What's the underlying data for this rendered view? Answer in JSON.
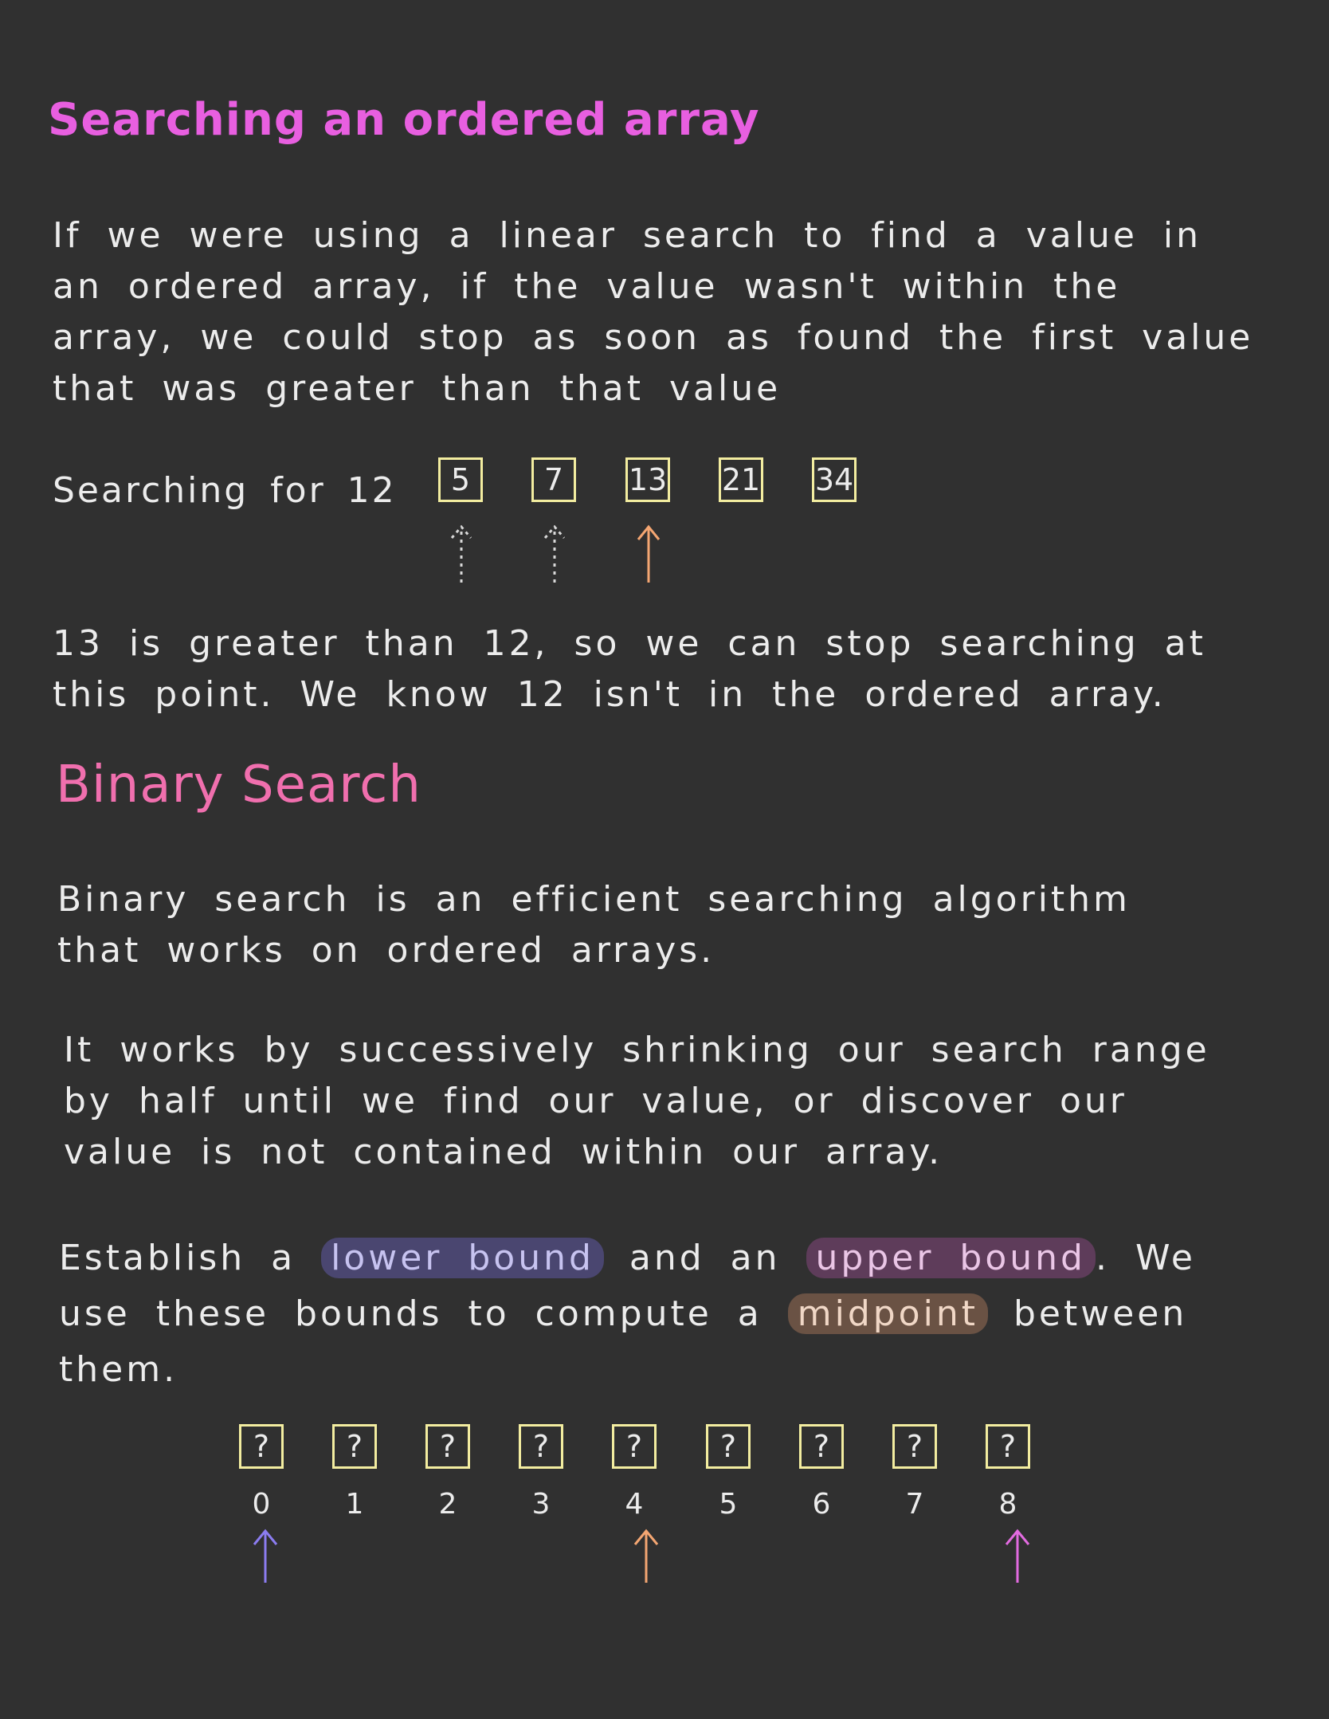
{
  "heading_ordered": "Searching an ordered array",
  "para_linear": "If we were using a linear search to find a value in an ordered array, if the value wasn't within the array, we could stop as soon as found the first value that was greater than that value",
  "example": {
    "label": "Searching for 12",
    "cells": [
      "5",
      "7",
      "13",
      "21",
      "34"
    ]
  },
  "para_stop": "13 is greater than 12, so we can stop searching at this point. We know 12 isn't in the ordered array.",
  "heading_binary": "Binary Search",
  "para_binary_intro": "Binary search is an efficient searching algorithm that works on ordered arrays.",
  "para_binary_works": "It works by successively shrinking our search range by half until we find our value, or discover our value is not contained within our array.",
  "bounds": {
    "t1": "Establish a ",
    "lower": "lower bound",
    "t2": " and an ",
    "upper": "upper bound",
    "t3": ". We use these bounds to compute a ",
    "mid": "midpoint",
    "t4": " between them."
  },
  "array2": {
    "cells": [
      "?",
      "?",
      "?",
      "?",
      "?",
      "?",
      "?",
      "?",
      "?"
    ],
    "indices": [
      "0",
      "1",
      "2",
      "3",
      "4",
      "5",
      "6",
      "7",
      "8"
    ]
  },
  "colors": {
    "cell_border": "#f3eda0",
    "arrow_checked": "#d8d8d8",
    "arrow_current": "#f4a672",
    "arrow_lower": "#8b7cf0",
    "arrow_mid": "#f4a672",
    "arrow_upper": "#e26be0"
  }
}
